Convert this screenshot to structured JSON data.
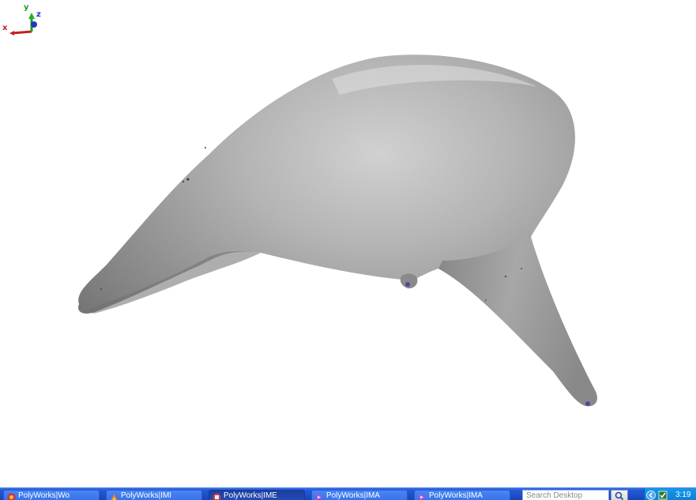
{
  "viewport": {
    "axes": {
      "y": "y",
      "z": "z",
      "x": "x"
    }
  },
  "taskbar": {
    "buttons": [
      {
        "label": "PolyWorks|Wo",
        "icon": "polyworks-workspace-icon"
      },
      {
        "label": "PolyWorks|IMI",
        "icon": "polyworks-imi-icon"
      },
      {
        "label": "PolyWorks|IME",
        "icon": "polyworks-ime-icon"
      },
      {
        "label": "PolyWorks|IMA",
        "icon": "polyworks-ima-icon"
      },
      {
        "label": "PolyWorks|IMA",
        "icon": "polyworks-ima-icon"
      }
    ],
    "search_placeholder": "Search Desktop",
    "clock": "3:19"
  },
  "colors": {
    "taskbar_blue": "#2456d6",
    "tray_blue": "#0c7fd6",
    "model_gray": "#9a9a9a",
    "axis_x": "#d02020",
    "axis_y": "#20a020",
    "axis_z": "#2040c0"
  }
}
